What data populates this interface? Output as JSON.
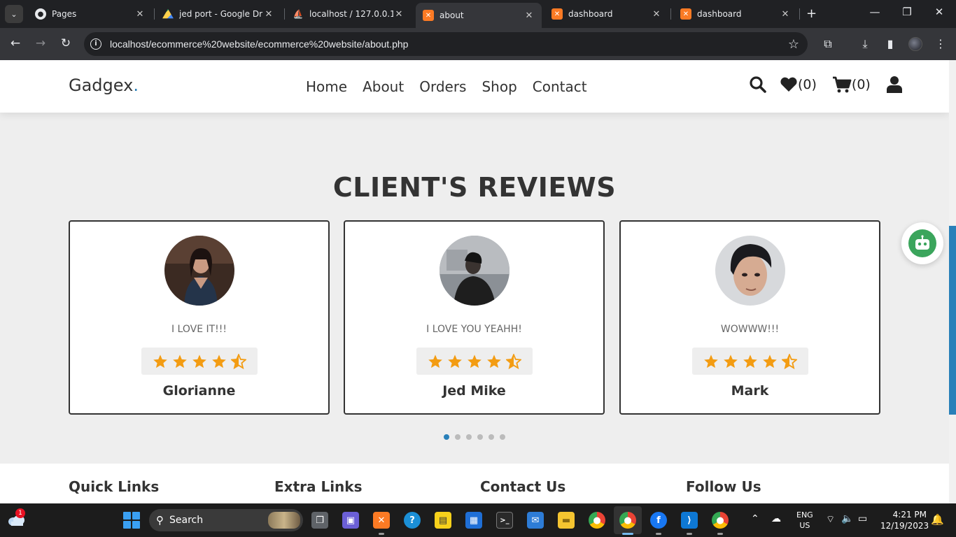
{
  "browser": {
    "tabs": [
      {
        "title": "Pages",
        "favicon": "github-icon",
        "active": false
      },
      {
        "title": "jed port - Google Driv",
        "favicon": "google-drive-icon",
        "active": false
      },
      {
        "title": "localhost / 127.0.0.1 /",
        "favicon": "phpmyadmin-icon",
        "active": false
      },
      {
        "title": "about",
        "favicon": "xampp-icon",
        "active": true
      },
      {
        "title": "dashboard",
        "favicon": "xampp-icon",
        "active": false
      },
      {
        "title": "dashboard",
        "favicon": "xampp-icon",
        "active": false
      }
    ],
    "url": "localhost/ecommerce%20website/ecommerce%20website/about.php"
  },
  "site": {
    "logo": "Gadgex",
    "logo_dot": ".",
    "nav": [
      "Home",
      "About",
      "Orders",
      "Shop",
      "Contact"
    ],
    "wishlist_count": "(0)",
    "cart_count": "(0)"
  },
  "reviews": {
    "title": "CLIENT'S REVIEWS",
    "items": [
      {
        "text": "I LOVE IT!!!",
        "name": "Glorianne",
        "rating": 4.5
      },
      {
        "text": "I LOVE YOU YEAHH!",
        "name": "Jed Mike",
        "rating": 4.5
      },
      {
        "text": "WOWWW!!!",
        "name": "Mark",
        "rating": 4.5
      }
    ],
    "pages": 6,
    "active_page": 0
  },
  "footer": {
    "columns": [
      "Quick Links",
      "Extra Links",
      "Contact Us",
      "Follow Us"
    ]
  },
  "colors": {
    "accent": "#2980b9",
    "star": "#f39c12"
  },
  "taskbar": {
    "weather_badge": "1",
    "search_placeholder": "Search",
    "lang_line1": "ENG",
    "lang_line2": "US",
    "time": "4:21 PM",
    "date": "12/19/2023"
  }
}
